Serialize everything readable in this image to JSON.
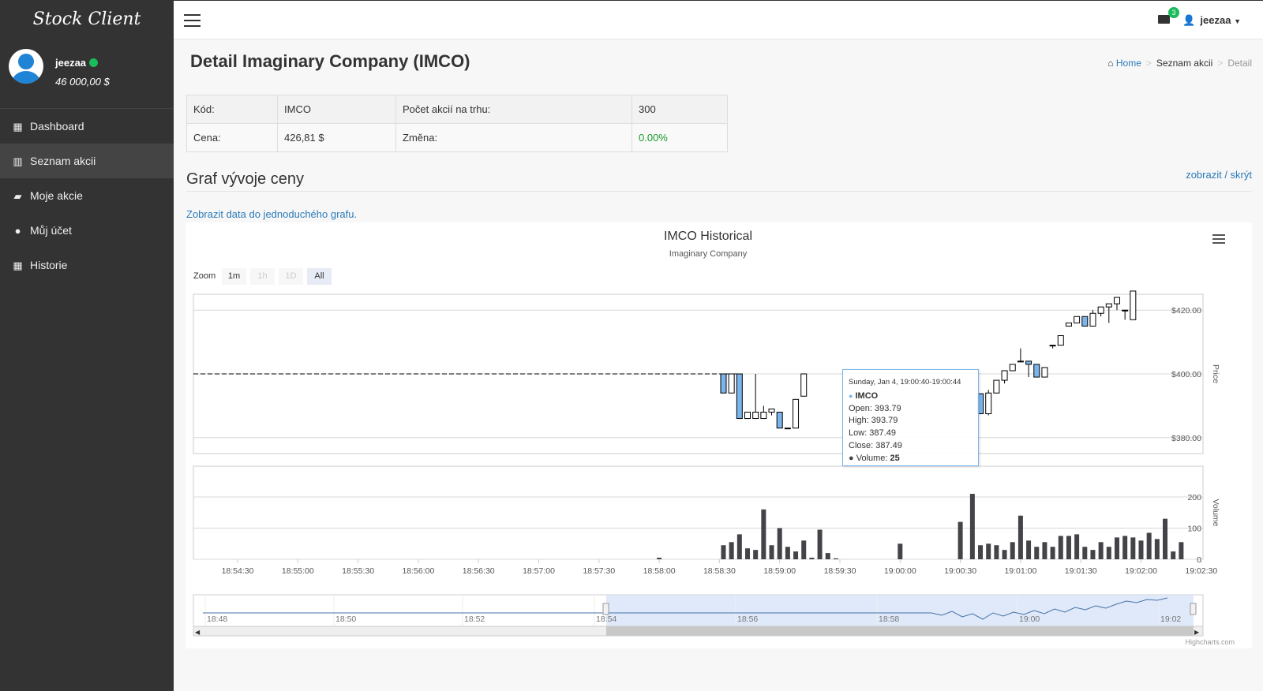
{
  "app": {
    "brand": "Stock Client"
  },
  "user": {
    "name": "jeezaa",
    "balance": "46 000,00 $"
  },
  "sidebar": {
    "items": [
      {
        "label": "Dashboard",
        "icon": "grid-icon"
      },
      {
        "label": "Seznam akcii",
        "icon": "bar-chart-icon"
      },
      {
        "label": "Moje akcie",
        "icon": "book-icon"
      },
      {
        "label": "Můj účet",
        "icon": "user-icon"
      },
      {
        "label": "Historie",
        "icon": "calendar-icon"
      }
    ]
  },
  "topbar": {
    "notification_count": "3",
    "user_label": "jeezaa"
  },
  "page": {
    "title": "Detail Imaginary Company (IMCO)",
    "breadcrumb": {
      "home": "Home",
      "list": "Seznam akcii",
      "current": "Detail"
    }
  },
  "info": {
    "code_label": "Kód:",
    "code": "IMCO",
    "shares_label": "Počet akcií na trhu:",
    "shares": "300",
    "price_label": "Cena:",
    "price": "426,81 $",
    "change_label": "Změna:",
    "change": "0.00%"
  },
  "section": {
    "title": "Graf vývoje ceny",
    "toggle_link": "zobrazit / skrýt",
    "simple_link": "Zobrazit data do jednoduchého grafu."
  },
  "chart_controls": {
    "zoom_label": "Zoom",
    "buttons": [
      "1m",
      "1h",
      "1D",
      "All"
    ],
    "credits": "Highcharts.com"
  },
  "tooltip": {
    "date": "Sunday, Jan 4, 19:00:40-19:00:44",
    "series": "IMCO",
    "open": "Open: 393.79",
    "high": "High: 393.79",
    "low": "Low: 387.49",
    "close": "Close: 387.49",
    "volume_label": "Volume: ",
    "volume": "25"
  },
  "chart_data": {
    "type": "candlestick",
    "title": "IMCO Historical",
    "subtitle": "Imaginary Company",
    "price_axis_label": "Price",
    "volume_axis_label": "Volume",
    "price_ticks": [
      "$380.00",
      "$400.00",
      "$420.00"
    ],
    "price_range": [
      375,
      425
    ],
    "volume_ticks": [
      "0",
      "100",
      "200"
    ],
    "volume_range": [
      0,
      200
    ],
    "x_ticks": [
      "18:54:30",
      "18:55:00",
      "18:55:30",
      "18:56:00",
      "18:56:30",
      "18:57:00",
      "18:57:30",
      "18:58:00",
      "18:58:30",
      "18:59:00",
      "18:59:30",
      "19:00:00",
      "19:00:30",
      "19:01:00",
      "19:01:30",
      "19:02:00",
      "19:02:30"
    ],
    "navigator_ticks": [
      "18:48",
      "18:50",
      "18:52",
      "18:54",
      "18:56",
      "18:58",
      "19:00",
      "19:02"
    ],
    "reference_price": 400,
    "candles": [
      {
        "t": "18:58:32",
        "o": 400,
        "h": 400,
        "l": 394,
        "c": 394
      },
      {
        "t": "18:58:36",
        "o": 394,
        "h": 400,
        "l": 394,
        "c": 400
      },
      {
        "t": "18:58:40",
        "o": 400,
        "h": 400,
        "l": 386,
        "c": 386
      },
      {
        "t": "18:58:44",
        "o": 386,
        "h": 386,
        "l": 386,
        "c": 388
      },
      {
        "t": "18:58:48",
        "o": 386,
        "h": 400,
        "l": 386,
        "c": 388
      },
      {
        "t": "18:58:52",
        "o": 386,
        "h": 390,
        "l": 386,
        "c": 388
      },
      {
        "t": "18:58:56",
        "o": 388,
        "h": 389,
        "l": 387,
        "c": 389
      },
      {
        "t": "18:59:00",
        "o": 388,
        "h": 388,
        "l": 383,
        "c": 383
      },
      {
        "t": "18:59:04",
        "o": 383,
        "h": 383,
        "l": 383,
        "c": 383
      },
      {
        "t": "18:59:08",
        "o": 383,
        "h": 392,
        "l": 383,
        "c": 392
      },
      {
        "t": "18:59:12",
        "o": 393,
        "h": 400,
        "l": 393,
        "c": 400
      },
      {
        "t": "19:00:40",
        "o": 393.79,
        "h": 393.79,
        "l": 387.49,
        "c": 387.49
      },
      {
        "t": "19:00:44",
        "o": 387.49,
        "h": 395,
        "l": 387,
        "c": 394
      },
      {
        "t": "19:00:48",
        "o": 394,
        "h": 398,
        "l": 394,
        "c": 398
      },
      {
        "t": "19:00:52",
        "o": 398,
        "h": 401,
        "l": 397,
        "c": 401
      },
      {
        "t": "19:00:56",
        "o": 401,
        "h": 403,
        "l": 401,
        "c": 403
      },
      {
        "t": "19:01:00",
        "o": 404,
        "h": 408,
        "l": 404,
        "c": 404
      },
      {
        "t": "19:01:04",
        "o": 404,
        "h": 404,
        "l": 399,
        "c": 403
      },
      {
        "t": "19:01:08",
        "o": 403,
        "h": 403,
        "l": 399,
        "c": 399
      },
      {
        "t": "19:01:12",
        "o": 399,
        "h": 402,
        "l": 399,
        "c": 402
      },
      {
        "t": "19:01:16",
        "o": 409,
        "h": 409,
        "l": 408,
        "c": 409
      },
      {
        "t": "19:01:20",
        "o": 409,
        "h": 412,
        "l": 409,
        "c": 412
      },
      {
        "t": "19:01:24",
        "o": 415,
        "h": 416,
        "l": 415,
        "c": 416
      },
      {
        "t": "19:01:28",
        "o": 416,
        "h": 418,
        "l": 416,
        "c": 418
      },
      {
        "t": "19:01:32",
        "o": 418,
        "h": 418,
        "l": 415,
        "c": 415
      },
      {
        "t": "19:01:36",
        "o": 415,
        "h": 420,
        "l": 415,
        "c": 419
      },
      {
        "t": "19:01:40",
        "o": 419,
        "h": 421,
        "l": 418,
        "c": 421
      },
      {
        "t": "19:01:44",
        "o": 421,
        "h": 422,
        "l": 416,
        "c": 422
      },
      {
        "t": "19:01:48",
        "o": 422,
        "h": 424,
        "l": 420,
        "c": 424
      },
      {
        "t": "19:01:52",
        "o": 420,
        "h": 420,
        "l": 417,
        "c": 420
      },
      {
        "t": "19:01:56",
        "o": 417,
        "h": 426,
        "l": 417,
        "c": 426
      }
    ],
    "volume": [
      {
        "t": "18:58:00",
        "v": 5
      },
      {
        "t": "18:58:32",
        "v": 45
      },
      {
        "t": "18:58:36",
        "v": 55
      },
      {
        "t": "18:58:40",
        "v": 80
      },
      {
        "t": "18:58:44",
        "v": 35
      },
      {
        "t": "18:58:48",
        "v": 30
      },
      {
        "t": "18:58:52",
        "v": 160
      },
      {
        "t": "18:58:56",
        "v": 45
      },
      {
        "t": "18:59:00",
        "v": 100
      },
      {
        "t": "18:59:04",
        "v": 40
      },
      {
        "t": "18:59:08",
        "v": 25
      },
      {
        "t": "18:59:12",
        "v": 60
      },
      {
        "t": "18:59:16",
        "v": 5
      },
      {
        "t": "18:59:20",
        "v": 95
      },
      {
        "t": "18:59:24",
        "v": 20
      },
      {
        "t": "18:59:28",
        "v": 3
      },
      {
        "t": "19:00:00",
        "v": 50
      },
      {
        "t": "19:00:30",
        "v": 120
      },
      {
        "t": "19:00:36",
        "v": 210
      },
      {
        "t": "19:00:40",
        "v": 45
      },
      {
        "t": "19:00:44",
        "v": 50
      },
      {
        "t": "19:00:48",
        "v": 45
      },
      {
        "t": "19:00:52",
        "v": 30
      },
      {
        "t": "19:00:56",
        "v": 55
      },
      {
        "t": "19:01:00",
        "v": 140
      },
      {
        "t": "19:01:04",
        "v": 60
      },
      {
        "t": "19:01:08",
        "v": 40
      },
      {
        "t": "19:01:12",
        "v": 55
      },
      {
        "t": "19:01:16",
        "v": 40
      },
      {
        "t": "19:01:20",
        "v": 75
      },
      {
        "t": "19:01:24",
        "v": 75
      },
      {
        "t": "19:01:28",
        "v": 80
      },
      {
        "t": "19:01:32",
        "v": 40
      },
      {
        "t": "19:01:36",
        "v": 30
      },
      {
        "t": "19:01:40",
        "v": 55
      },
      {
        "t": "19:01:44",
        "v": 40
      },
      {
        "t": "19:01:48",
        "v": 70
      },
      {
        "t": "19:01:52",
        "v": 75
      },
      {
        "t": "19:01:56",
        "v": 70
      },
      {
        "t": "19:02:00",
        "v": 60
      },
      {
        "t": "19:02:04",
        "v": 85
      },
      {
        "t": "19:02:08",
        "v": 65
      },
      {
        "t": "19:02:12",
        "v": 130
      },
      {
        "t": "19:02:16",
        "v": 25
      },
      {
        "t": "19:02:20",
        "v": 55
      }
    ],
    "colors": {
      "down": "#7cb5ec",
      "up": "#ffffff",
      "outline": "#000000",
      "volume": "#434348",
      "navigator": "#4572a7",
      "navigator_mask": "#d7e4f7"
    }
  }
}
